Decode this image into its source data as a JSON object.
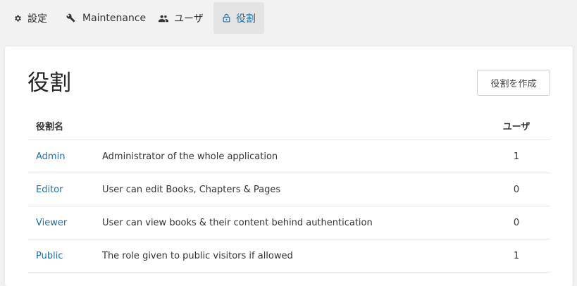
{
  "nav": {
    "items": [
      {
        "label": "設定",
        "icon": "gear-icon",
        "active": false
      },
      {
        "label": "Maintenance",
        "icon": "wrench-icon",
        "active": false
      },
      {
        "label": "ユーザ",
        "icon": "users-icon",
        "active": false
      },
      {
        "label": "役割",
        "icon": "lock-icon",
        "active": true
      }
    ]
  },
  "page": {
    "title": "役割",
    "create_button": "役割を作成"
  },
  "table": {
    "headers": {
      "name": "役割名",
      "users": "ユーザ"
    },
    "rows": [
      {
        "name": "Admin",
        "description": "Administrator of the whole application",
        "users": "1"
      },
      {
        "name": "Editor",
        "description": "User can edit Books, Chapters & Pages",
        "users": "0"
      },
      {
        "name": "Viewer",
        "description": "User can view books & their content behind authentication",
        "users": "0"
      },
      {
        "name": "Public",
        "description": "The role given to public visitors if allowed",
        "users": "1"
      }
    ]
  },
  "colors": {
    "link": "#206ea7",
    "active_tab_bg": "#e4e4e4",
    "background": "#f2f2f2"
  }
}
